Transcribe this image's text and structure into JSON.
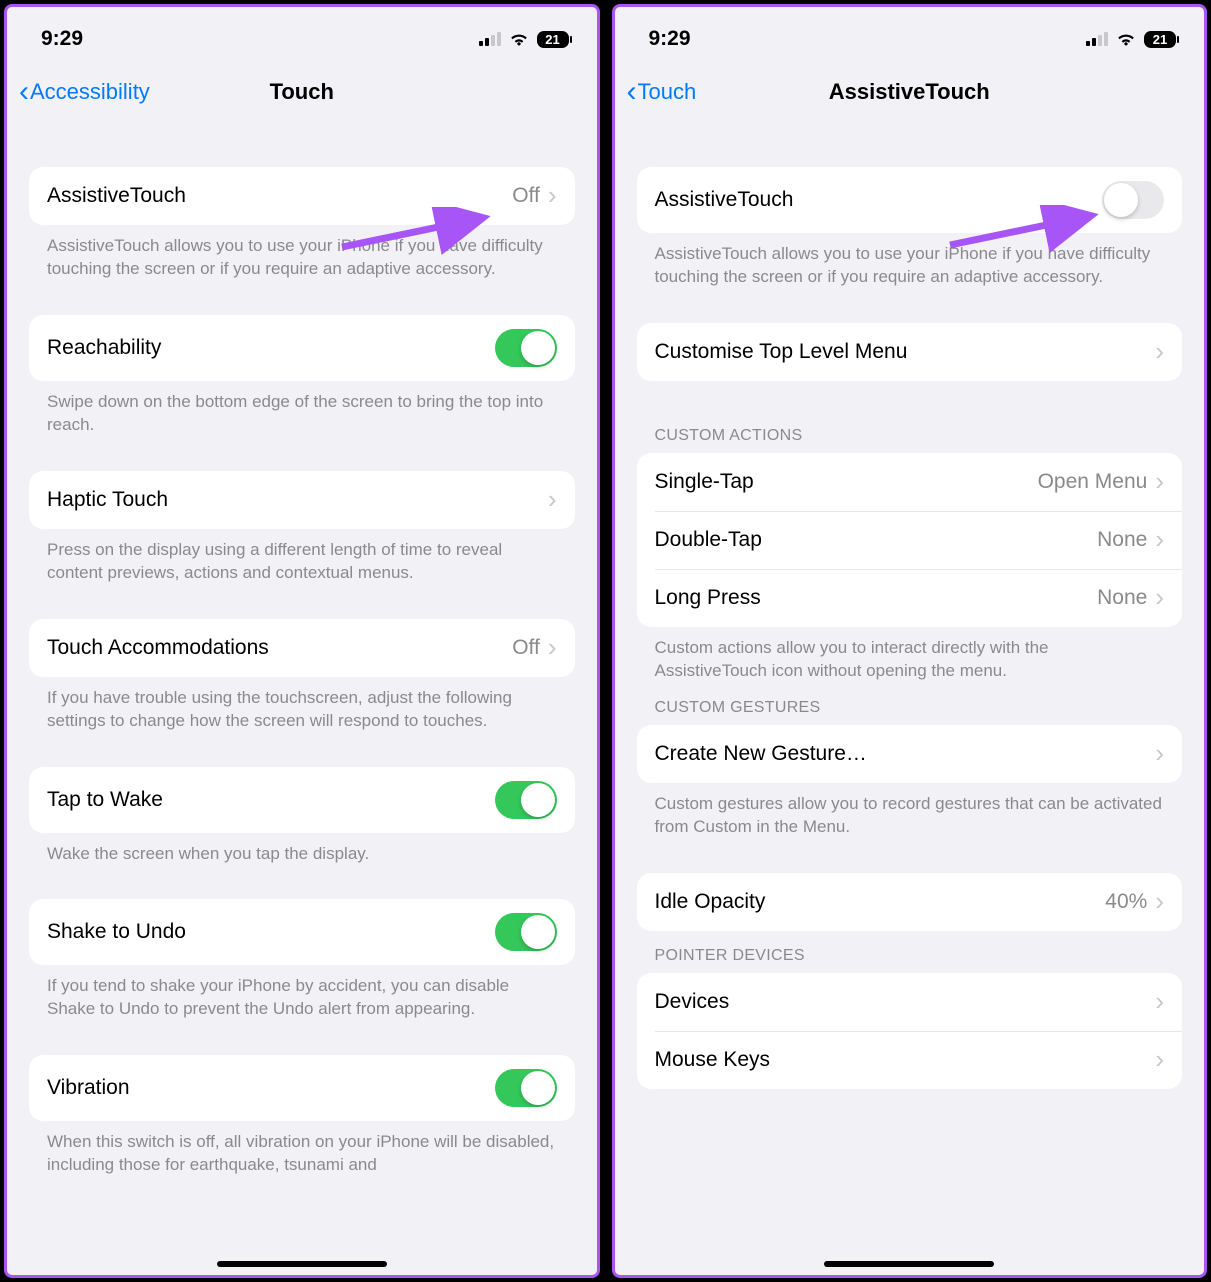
{
  "status": {
    "time": "9:29",
    "battery": "21"
  },
  "left": {
    "back": "Accessibility",
    "title": "Touch",
    "rows": {
      "assistive": {
        "label": "AssistiveTouch",
        "value": "Off"
      },
      "assistive_footer": "AssistiveTouch allows you to use your iPhone if you have difficulty touching the screen or if you require an adaptive accessory.",
      "reach": {
        "label": "Reachability"
      },
      "reach_footer": "Swipe down on the bottom edge of the screen to bring the top into reach.",
      "haptic": {
        "label": "Haptic Touch"
      },
      "haptic_footer": "Press on the display using a different length of time to reveal content previews, actions and contextual menus.",
      "accom": {
        "label": "Touch Accommodations",
        "value": "Off"
      },
      "accom_footer": "If you have trouble using the touchscreen, adjust the following settings to change how the screen will respond to touches.",
      "tapwake": {
        "label": "Tap to Wake"
      },
      "tapwake_footer": "Wake the screen when you tap the display.",
      "shake": {
        "label": "Shake to Undo"
      },
      "shake_footer": "If you tend to shake your iPhone by accident, you can disable Shake to Undo to prevent the Undo alert from appearing.",
      "vibration": {
        "label": "Vibration"
      },
      "vibration_footer": "When this switch is off, all vibration on your iPhone will be disabled, including those for earthquake, tsunami and"
    }
  },
  "right": {
    "back": "Touch",
    "title": "AssistiveTouch",
    "rows": {
      "assistive": {
        "label": "AssistiveTouch"
      },
      "assistive_footer": "AssistiveTouch allows you to use your iPhone if you have difficulty touching the screen or if you require an adaptive accessory.",
      "customise": {
        "label": "Customise Top Level Menu"
      }
    },
    "sections": {
      "custom_actions": {
        "header": "CUSTOM ACTIONS",
        "rows": {
          "single": {
            "label": "Single-Tap",
            "value": "Open Menu"
          },
          "double": {
            "label": "Double-Tap",
            "value": "None"
          },
          "long": {
            "label": "Long Press",
            "value": "None"
          }
        },
        "footer": "Custom actions allow you to interact directly with the AssistiveTouch icon without opening the menu."
      },
      "custom_gestures": {
        "header": "CUSTOM GESTURES",
        "rows": {
          "create": {
            "label": "Create New Gesture…"
          }
        },
        "footer": "Custom gestures allow you to record gestures that can be activated from Custom in the Menu."
      },
      "idle": {
        "label": "Idle Opacity",
        "value": "40%"
      },
      "pointer": {
        "header": "POINTER DEVICES",
        "rows": {
          "devices": {
            "label": "Devices"
          },
          "mousekeys": {
            "label": "Mouse Keys"
          }
        }
      }
    }
  }
}
